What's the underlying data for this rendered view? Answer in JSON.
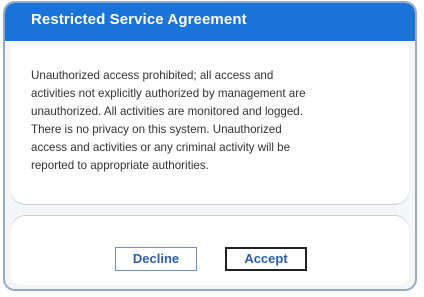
{
  "dialog": {
    "title": "Restricted Service Agreement",
    "message": "Unauthorized access prohibited; all access and\nactivities not explicitly authorized by management are\nunauthorized. All activities are monitored and logged.\nThere is no privacy on this system. Unauthorized\naccess and activities or any criminal activity will be\nreported to appropriate authorities."
  },
  "buttons": {
    "decline_label": "Decline",
    "accept_label": "Accept"
  },
  "colors": {
    "title_bar": "#1a73d6",
    "title_text": "#ffffff",
    "dialog_border": "#9aa9bf",
    "button_text": "#2a5fae"
  }
}
